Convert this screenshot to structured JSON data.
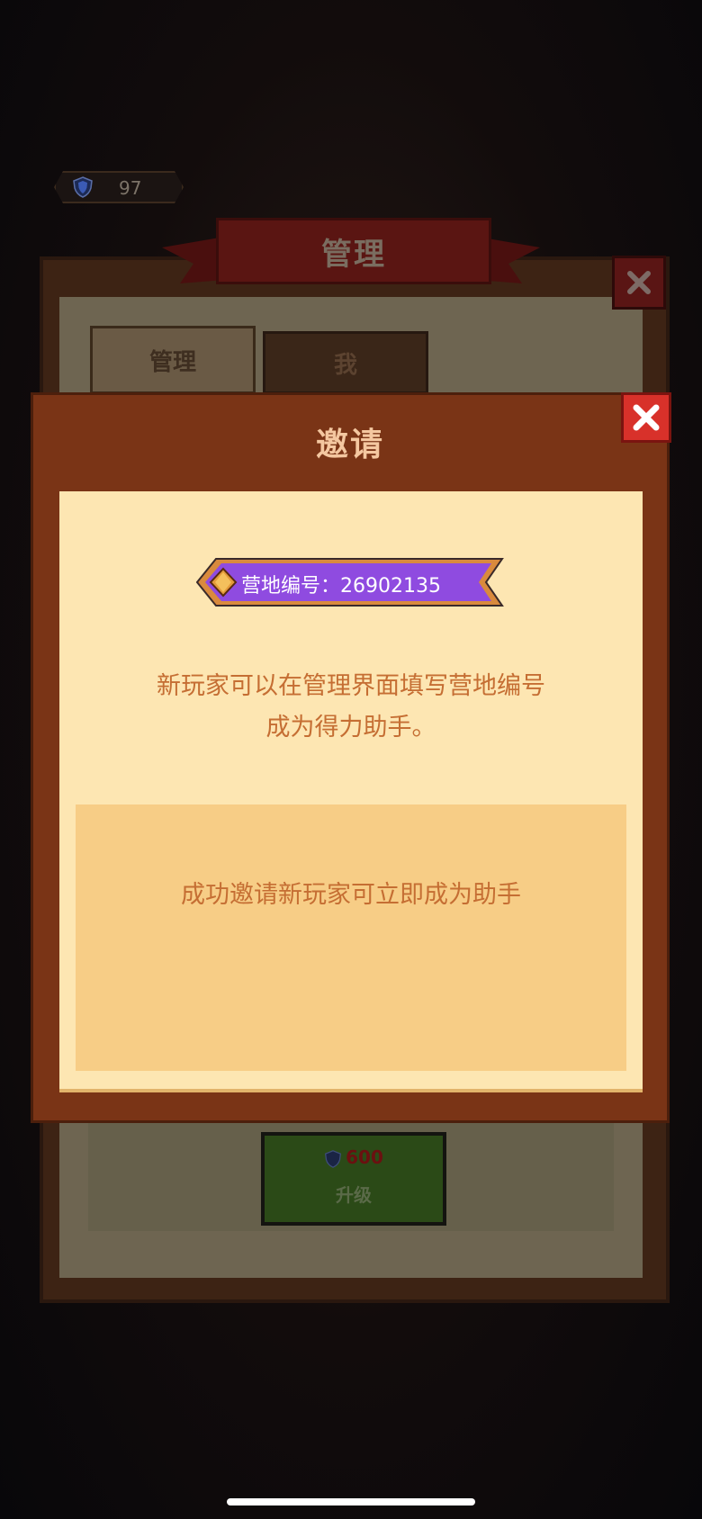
{
  "hud": {
    "trophies": "97"
  },
  "background_panel": {
    "title": "管理",
    "tabs": [
      "管理",
      "我"
    ],
    "upgrade_cost": "600",
    "upgrade_label": "升级"
  },
  "dialog": {
    "title": "邀请",
    "camp_id_label": "营地编号：",
    "camp_id": "26902135",
    "description_line1": "新玩家可以在管理界面填写营地编号",
    "description_line2": "成为得力助手。",
    "reward_text": "成功邀请新玩家可立即成为助手"
  },
  "colors": {
    "dialog_frame": "#7a3416",
    "content_bg": "#fde6b2",
    "reward_box": "#f7cd86",
    "text_orange": "#c56e33",
    "badge_purple": "#8f4be0",
    "close_red": "#d8312a"
  },
  "icons": [
    "shield-icon",
    "close-icon",
    "diamond-icon"
  ]
}
